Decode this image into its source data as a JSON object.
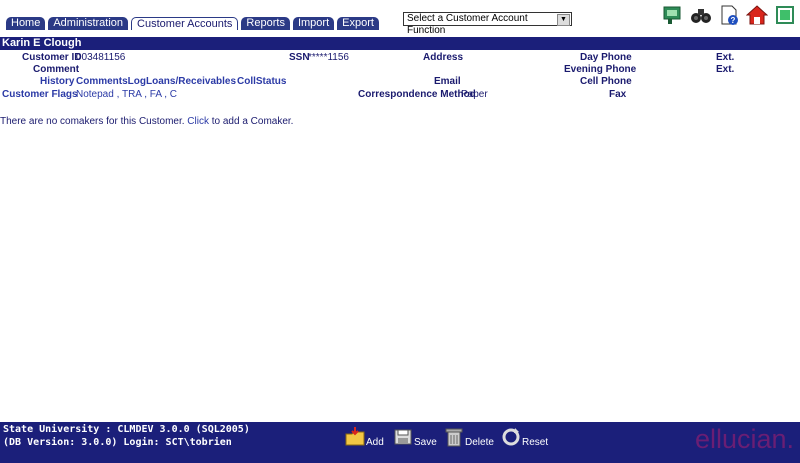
{
  "tabs": [
    {
      "label": "Home",
      "active": false
    },
    {
      "label": "Administration",
      "active": false
    },
    {
      "label": "Customer Accounts",
      "active": true
    },
    {
      "label": "Reports",
      "active": false
    },
    {
      "label": "Import",
      "active": false
    },
    {
      "label": "Export",
      "active": false
    }
  ],
  "function_select": {
    "value": "Select a Customer Account Function"
  },
  "top_icons": [
    "directory-icon",
    "binoculars-icon",
    "help-document-icon",
    "home-icon",
    "exit-icon"
  ],
  "customer": {
    "name": "Karin E Clough",
    "customer_id_label": "Customer ID",
    "customer_id": "003481156",
    "ssn_label": "SSN",
    "ssn": "*****1156",
    "address_label": "Address",
    "comment_label": "Comment",
    "email_label": "Email",
    "correspondence_label": "Correspondence Method",
    "correspondence_value": "Paper",
    "day_phone_label": "Day Phone",
    "evening_phone_label": "Evening Phone",
    "cell_phone_label": "Cell Phone",
    "fax_label": "Fax",
    "ext1_label": "Ext.",
    "ext2_label": "Ext."
  },
  "links": {
    "history": "History",
    "comments_log": "CommentsLog",
    "loans": "Loans/Receivables",
    "coll_status": "CollStatus",
    "customer_flags": "Customer Flags",
    "flag_notepad": "Notepad",
    "flag_tra": "TRA",
    "flag_fa": "FA",
    "flag_c": "C"
  },
  "message": {
    "text_before": "There are no comakers for this Customer. ",
    "link": "Click",
    "text_after": " to add a Comaker."
  },
  "footer": {
    "line1": "State University : CLMDEV 3.0.0 (SQL2005)",
    "line2": "(DB Version: 3.0.0) Login: SCT\\tobrien",
    "add": "Add",
    "save": "Save",
    "delete": "Delete",
    "reset": "Reset",
    "logo": "ellucian."
  },
  "colors": {
    "nav_blue": "#2b3a86",
    "bar_blue": "#1b1f7a",
    "logo_purple": "#6a1e74"
  }
}
